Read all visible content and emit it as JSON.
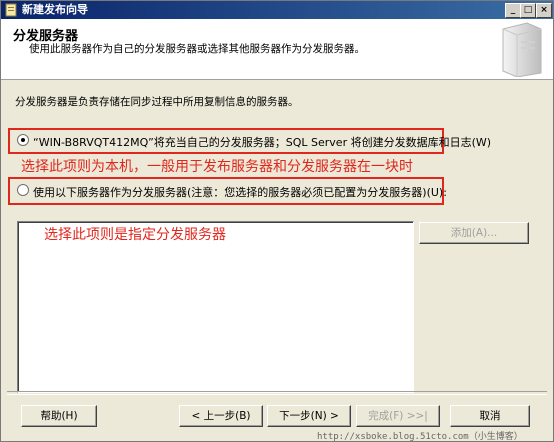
{
  "window": {
    "title": "新建发布向导",
    "controls": {
      "minimize": "_",
      "maximize": "□",
      "close": "×"
    }
  },
  "header": {
    "title": "分发服务器",
    "subtitle": "使用此服务器作为自己的分发服务器或选择其他服务器作为分发服务器。"
  },
  "intro": "分发服务器是负责存储在同步过程中所用复制信息的服务器。",
  "options": [
    {
      "label": "“WIN-B8RVQT412MQ”将充当自己的分发服务器；SQL Server 将创建分发数据库和日志(W)",
      "selected": true
    },
    {
      "label": "使用以下服务器作为分发服务器(注意：您选择的服务器必须已配置为分发服务器)(U):",
      "selected": false
    }
  ],
  "annotations": {
    "option1": "选择此项则为本机，一般用于发布服务器和分发服务器在一块时",
    "option2": "选择此项则是指定分发服务器"
  },
  "list": {
    "items": []
  },
  "buttons": {
    "add": "添加(A)...",
    "help": "帮助(H)",
    "back": "< 上一步(B)",
    "next": "下一步(N) >",
    "finish": "完成(F) >>|",
    "cancel": "取消"
  },
  "watermark": "http://xsboke.blog.51cto.com（小生博客）",
  "colors": {
    "annotation": "#e0271e",
    "titlebar": "#0a246a",
    "dialog": "#ece9d8"
  }
}
